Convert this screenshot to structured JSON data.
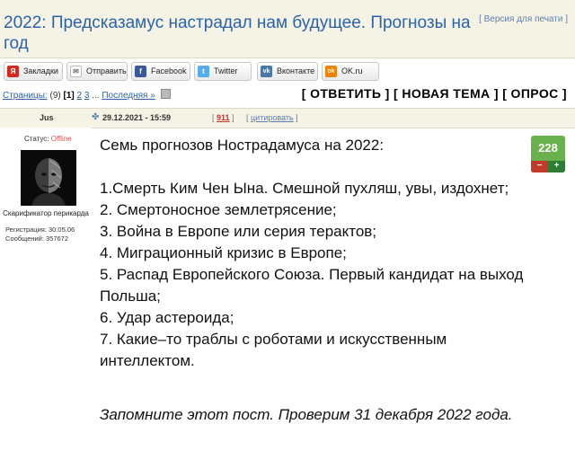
{
  "header": {
    "title": "2022: Предсказамус настрадал нам будущее. Прогнозы на год",
    "print_version": "[ Версия для печати ]"
  },
  "share": [
    {
      "label": "Закладки",
      "icon": "yandex-icon",
      "color": "#d52b1e",
      "glyph": "Я"
    },
    {
      "label": "Отправить",
      "icon": "mail-icon",
      "color": "#888888",
      "glyph": "✉"
    },
    {
      "label": "Facebook",
      "icon": "facebook-icon",
      "color": "#3b5998",
      "glyph": "f"
    },
    {
      "label": "Twitter",
      "icon": "twitter-icon",
      "color": "#55acee",
      "glyph": "t"
    },
    {
      "label": "Вконтакте",
      "icon": "vk-icon",
      "color": "#4a76a8",
      "glyph": "vk"
    },
    {
      "label": "OK.ru",
      "icon": "odnoklassniki-icon",
      "color": "#ee8208",
      "glyph": "ok"
    }
  ],
  "pager": {
    "label": "Страницы:",
    "count": "(9)",
    "current": "[1]",
    "p2": "2",
    "p3": "3",
    "ellipsis": "...",
    "last": "Последняя »"
  },
  "actions": {
    "reply": "[ ОТВЕТИТЬ ]",
    "new_topic": "[ НОВАЯ ТЕМА ]",
    "poll": "[ ОПРОС ]"
  },
  "post": {
    "author": "Jus",
    "date": "29.12.2021 - 15:59",
    "number": "911",
    "quote": "цитировать",
    "status_label": "Статус:",
    "status_value": "Offline",
    "user_title": "Скарификатор перикарда",
    "registration": "Регистрация: 30.05.06",
    "messages": "Сообщений: 357672",
    "rating": "228",
    "body": {
      "intro": "Семь прогнозов Нострадамуса на 2022:",
      "items": [
        "1.Смерть Ким Чен Ына. Смешной пухляш, увы, издохнет;",
        "2. Смертоносное землетрясение;",
        "3. Война в Европе или серия терактов;",
        "4. Миграционный кризис в Европе;",
        "5. Распад Европейского Союза. Первый кандидат на выход Польша;",
        "6. Удар астероида;",
        "7. Какие–то траблы с роботами и искусственным интеллектом."
      ],
      "outro": "Запомните этот пост. Проверим 31 декабря 2022 года."
    }
  }
}
